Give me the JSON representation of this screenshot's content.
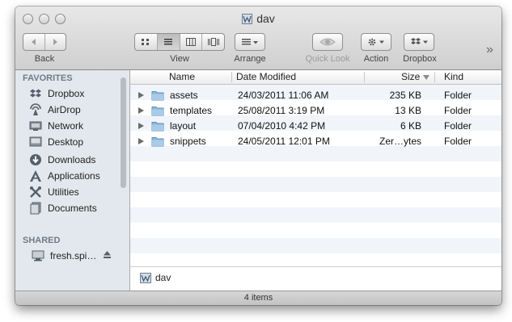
{
  "window": {
    "title": "dav"
  },
  "toolbar": {
    "back_label": "Back",
    "view_label": "View",
    "arrange_label": "Arrange",
    "quicklook_label": "Quick Look",
    "action_label": "Action",
    "dropbox_label": "Dropbox",
    "more_glyph": "»"
  },
  "sidebar": {
    "favorites_header": "FAVORITES",
    "favorites": [
      {
        "label": "Dropbox",
        "icon": "dropbox-icon"
      },
      {
        "label": "AirDrop",
        "icon": "airdrop-icon"
      },
      {
        "label": "Network",
        "icon": "network-icon"
      },
      {
        "label": "Desktop",
        "icon": "desktop-icon"
      },
      {
        "label": "Downloads",
        "icon": "downloads-icon"
      },
      {
        "label": "Applications",
        "icon": "applications-icon"
      },
      {
        "label": "Utilities",
        "icon": "utilities-icon"
      },
      {
        "label": "Documents",
        "icon": "documents-icon"
      }
    ],
    "shared_header": "SHARED",
    "shared": [
      {
        "label": "fresh.spi…",
        "icon": "computer-icon"
      }
    ]
  },
  "columns": {
    "name": "Name",
    "date": "Date Modified",
    "size": "Size",
    "kind": "Kind"
  },
  "files": [
    {
      "name": "assets",
      "date": "24/03/2011 11:06 AM",
      "size": "235 KB",
      "kind": "Folder"
    },
    {
      "name": "templates",
      "date": "25/08/2011 3:19 PM",
      "size": "13 KB",
      "kind": "Folder"
    },
    {
      "name": "layout",
      "date": "07/04/2010 4:42 PM",
      "size": "6 KB",
      "kind": "Folder"
    },
    {
      "name": "snippets",
      "date": "24/05/2011 12:01 PM",
      "size": "Zer…ytes",
      "kind": "Folder"
    }
  ],
  "pathbar": {
    "label": "dav"
  },
  "status": {
    "text": "4 items"
  },
  "colors": {
    "sidebar_bg": "#e3e8ee",
    "stripe": "#f1f5fa",
    "folder": "#8fb9dc"
  }
}
